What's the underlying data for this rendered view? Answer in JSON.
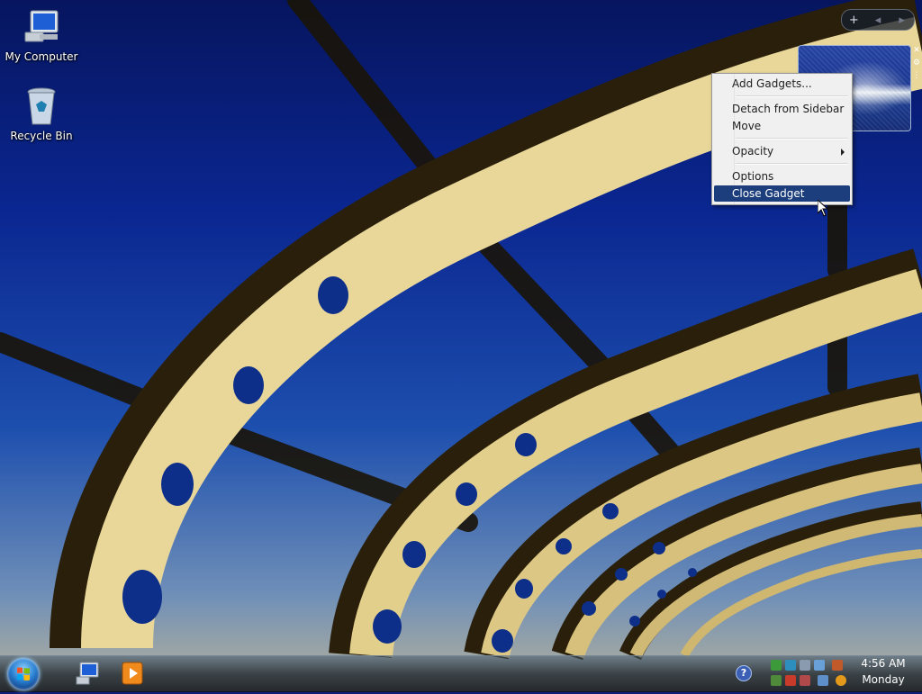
{
  "desktop": {
    "icons": [
      {
        "label": "My Computer",
        "icon": "computer-icon"
      },
      {
        "label": "Recycle Bin",
        "icon": "recycle-bin-icon"
      }
    ]
  },
  "sidebar": {
    "add_label": "+",
    "prev_label": "◂",
    "next_label": "▸"
  },
  "context_menu": {
    "items": [
      {
        "label": "Add Gadgets..."
      },
      {
        "label": "Detach from Sidebar"
      },
      {
        "label": "Move"
      },
      {
        "label": "Opacity",
        "has_submenu": true
      },
      {
        "label": "Options"
      },
      {
        "label": "Close Gadget",
        "highlighted": true
      }
    ],
    "highlight_color": "#1c3e7c"
  },
  "taskbar": {
    "clock_time": "4:56 AM",
    "clock_day": "Monday",
    "help_label": "?",
    "quick_launch": [
      "computer-icon",
      "media-player-icon"
    ]
  }
}
